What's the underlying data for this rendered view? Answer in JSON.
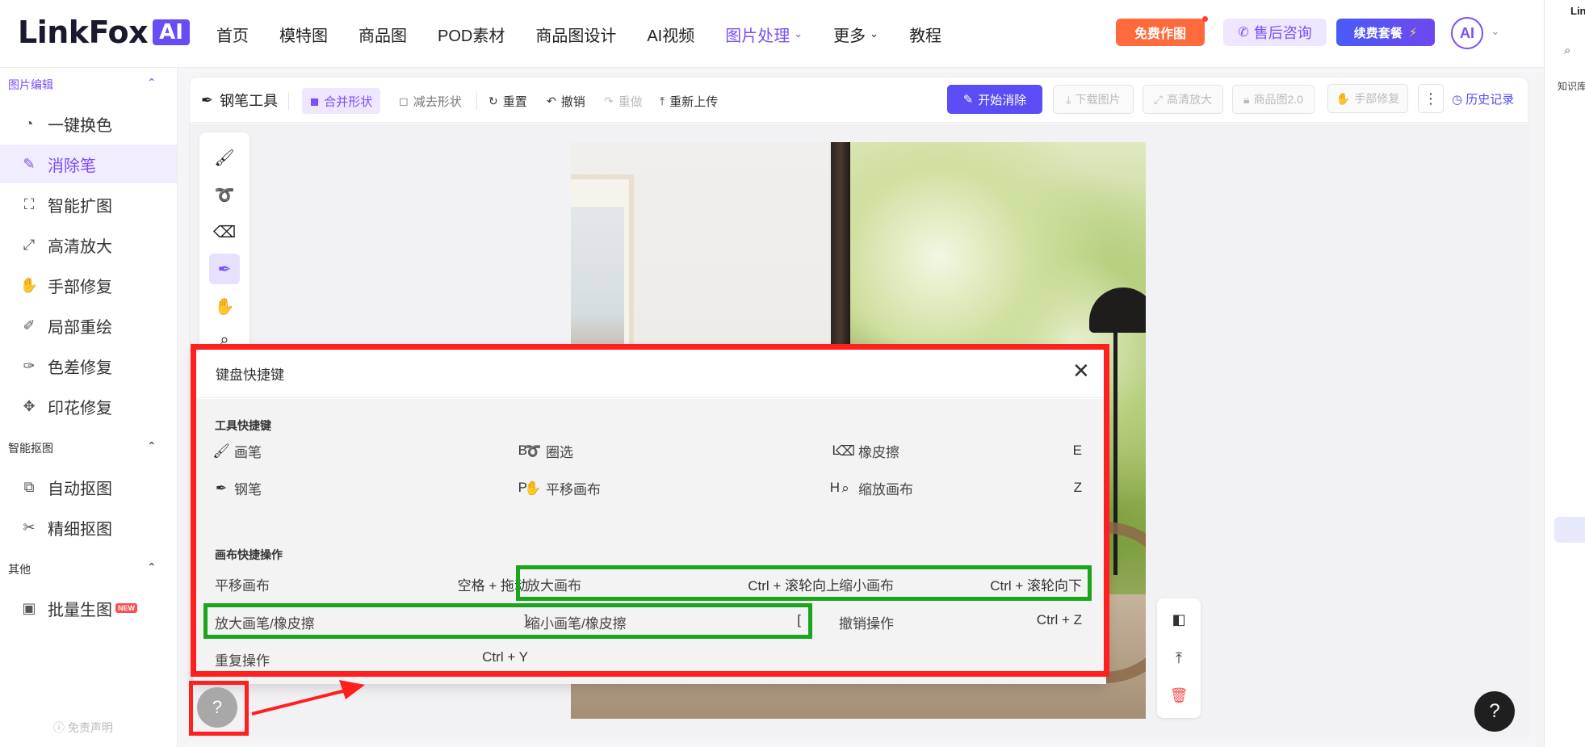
{
  "header": {
    "logo_text": "LinkFox",
    "logo_badge": "AI",
    "nav": [
      {
        "label": "首页",
        "active": false,
        "caret": false
      },
      {
        "label": "模特图",
        "active": false,
        "caret": false
      },
      {
        "label": "商品图",
        "active": false,
        "caret": false
      },
      {
        "label": "POD素材",
        "active": false,
        "caret": false
      },
      {
        "label": "商品图设计",
        "active": false,
        "caret": false
      },
      {
        "label": "AI视频",
        "active": false,
        "caret": false
      },
      {
        "label": "图片处理",
        "active": true,
        "caret": true
      },
      {
        "label": "更多",
        "active": false,
        "caret": true
      },
      {
        "label": "教程",
        "active": false,
        "caret": false
      }
    ],
    "free_button": "免费作图",
    "support_button": "售后咨询",
    "renew_button": "续费套餐",
    "avatar_text": "AI"
  },
  "right_panel": {
    "top_text": "Lin",
    "label": "知识库"
  },
  "sidebar": {
    "sections": [
      {
        "title": "图片编辑",
        "items": [
          {
            "label": "一键换色",
            "icon": "palette-icon",
            "active": false
          },
          {
            "label": "消除笔",
            "icon": "eraser-pen-icon",
            "active": true
          },
          {
            "label": "智能扩图",
            "icon": "expand-icon",
            "active": false
          },
          {
            "label": "高清放大",
            "icon": "upscale-icon",
            "active": false
          },
          {
            "label": "手部修复",
            "icon": "hand-icon",
            "active": false
          },
          {
            "label": "局部重绘",
            "icon": "brush-icon",
            "active": false
          },
          {
            "label": "色差修复",
            "icon": "color-fix-icon",
            "active": false
          },
          {
            "label": "印花修复",
            "icon": "pattern-icon",
            "active": false
          }
        ]
      },
      {
        "title": "智能抠图",
        "items": [
          {
            "label": "自动抠图",
            "icon": "auto-cutout-icon",
            "active": false
          },
          {
            "label": "精细抠图",
            "icon": "fine-cutout-icon",
            "active": false
          }
        ]
      },
      {
        "title": "其他",
        "items": [
          {
            "label": "批量生图",
            "icon": "image-batch-icon",
            "active": false,
            "badge": "NEW"
          }
        ]
      }
    ],
    "disclaimer": "免责声明"
  },
  "toolbar": {
    "title": "钢笔工具",
    "merge_shape": "合并形状",
    "subtract_shape": "减去形状",
    "reset": "重置",
    "undo": "撤销",
    "redo": "重做",
    "reupload": "重新上传",
    "start": "开始消除",
    "download": "下载图片",
    "upscale": "高清放大",
    "product2": "商品图2.0",
    "hand_fix": "手部修复",
    "more": "⋮",
    "history": "历史记录"
  },
  "dialog": {
    "title": "键盘快捷键",
    "tool_group_title": "工具快捷键",
    "tools": [
      {
        "name": "画笔",
        "key": "B",
        "icon": "brush-icon"
      },
      {
        "name": "圈选",
        "key": "L",
        "icon": "lasso-icon"
      },
      {
        "name": "橡皮擦",
        "key": "E",
        "icon": "eraser-icon"
      },
      {
        "name": "钢笔",
        "key": "P",
        "icon": "pen-icon"
      },
      {
        "name": "平移画布",
        "key": "H",
        "icon": "hand-icon"
      },
      {
        "name": "缩放画布",
        "key": "Z",
        "icon": "zoom-icon"
      }
    ],
    "canvas_group_title": "画布快捷操作",
    "canvas_ops": [
      {
        "name": "平移画布",
        "key": "空格 + 拖动"
      },
      {
        "name": "放大画布",
        "key": "Ctrl + 滚轮向上"
      },
      {
        "name": "缩小画布",
        "key": "Ctrl + 滚轮向下"
      },
      {
        "name": "放大画笔/橡皮擦",
        "key": "]"
      },
      {
        "name": "缩小画笔/橡皮擦",
        "key": "["
      },
      {
        "name": "撤销操作",
        "key": "Ctrl + Z"
      },
      {
        "name": "重复操作",
        "key": "Ctrl + Y"
      }
    ]
  },
  "help_button": "?",
  "colors": {
    "accent": "#7b4dfc",
    "annotation_red": "#ff1f1f",
    "annotation_green": "#1aa51a"
  }
}
